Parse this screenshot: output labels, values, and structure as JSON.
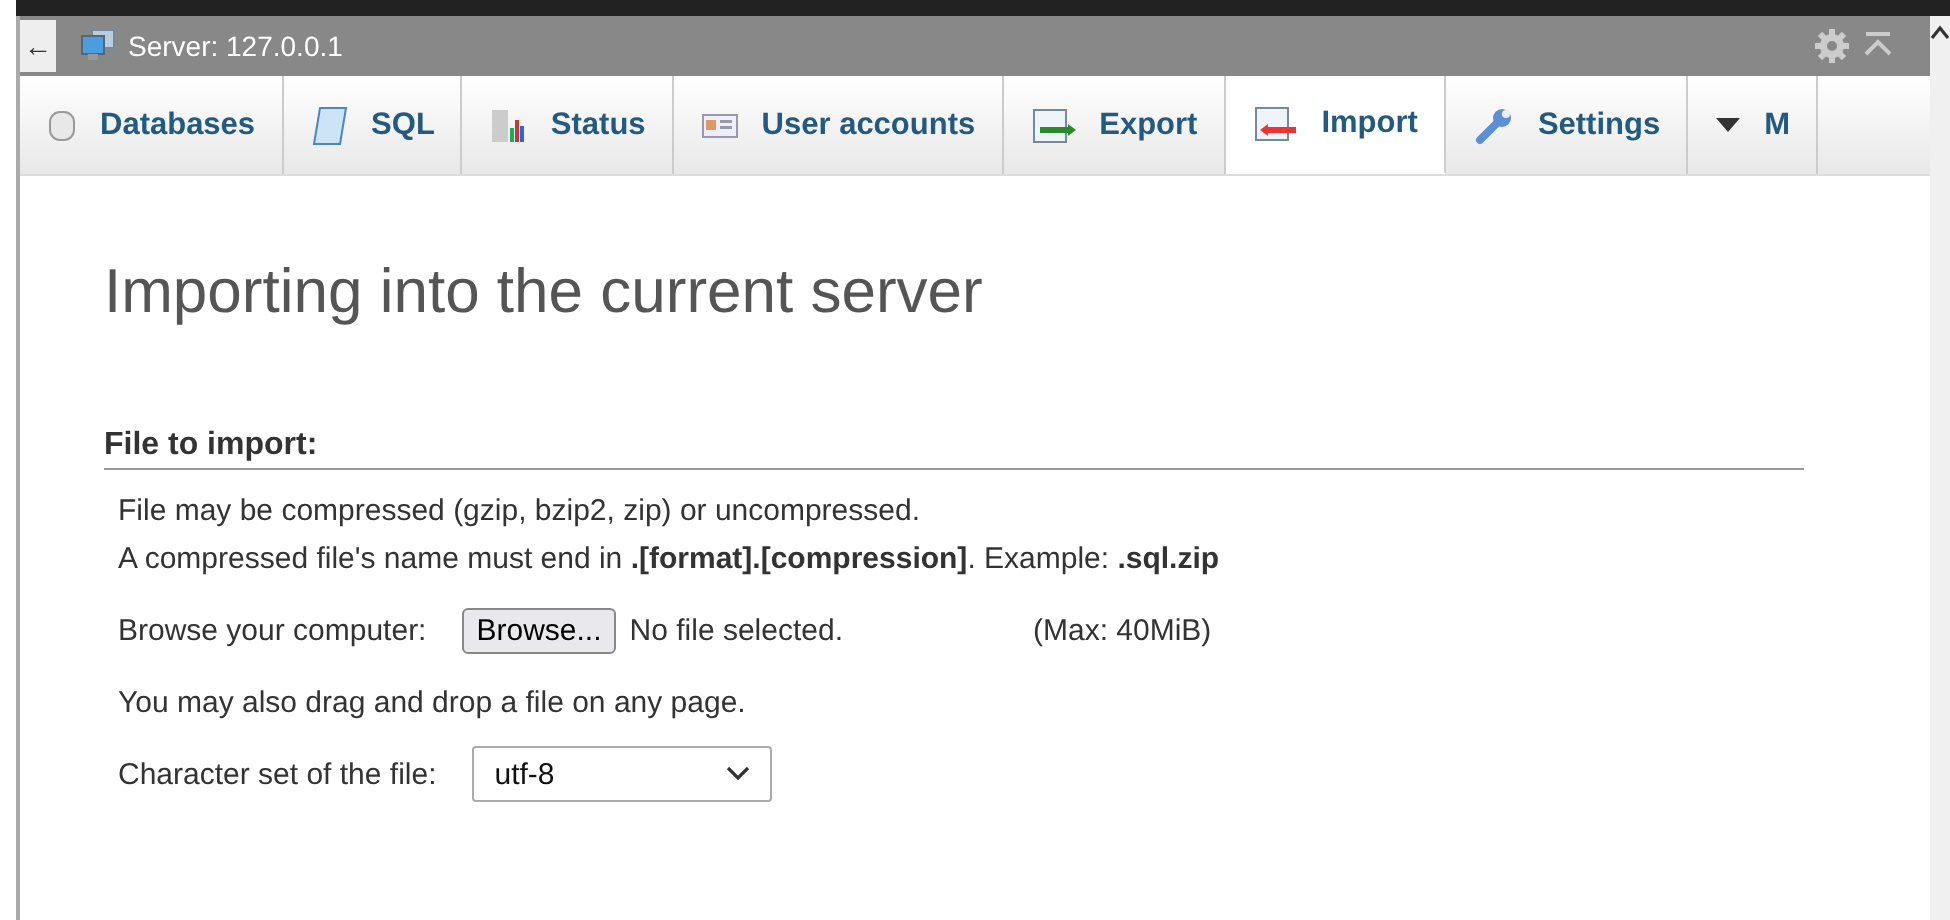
{
  "header": {
    "back": "←",
    "title": "Server: 127.0.0.1"
  },
  "tabs": [
    {
      "label": "Databases",
      "selected": false
    },
    {
      "label": "SQL",
      "selected": false
    },
    {
      "label": "Status",
      "selected": false
    },
    {
      "label": "User accounts",
      "selected": false
    },
    {
      "label": "Export",
      "selected": false
    },
    {
      "label": "Import",
      "selected": true
    },
    {
      "label": "Settings",
      "selected": false
    },
    {
      "label": "M",
      "selected": false
    }
  ],
  "heading": "Importing into the current server",
  "section": {
    "title": "File to import:",
    "notes": [
      "File may be compressed (gzip, bzip2, zip) or uncompressed.",
      "A compressed file's name must end in **.[format].[compression]**. Example: **.sql.zip**"
    ],
    "browse_label": "Browse your computer:",
    "browse_button": "Browse...",
    "file_status": "No file selected.",
    "max": "(Max: 40MiB)",
    "drag_note": "You may also drag and drop a file on any page.",
    "charset_label": "Character set of the file:",
    "charset": "utf-8"
  }
}
